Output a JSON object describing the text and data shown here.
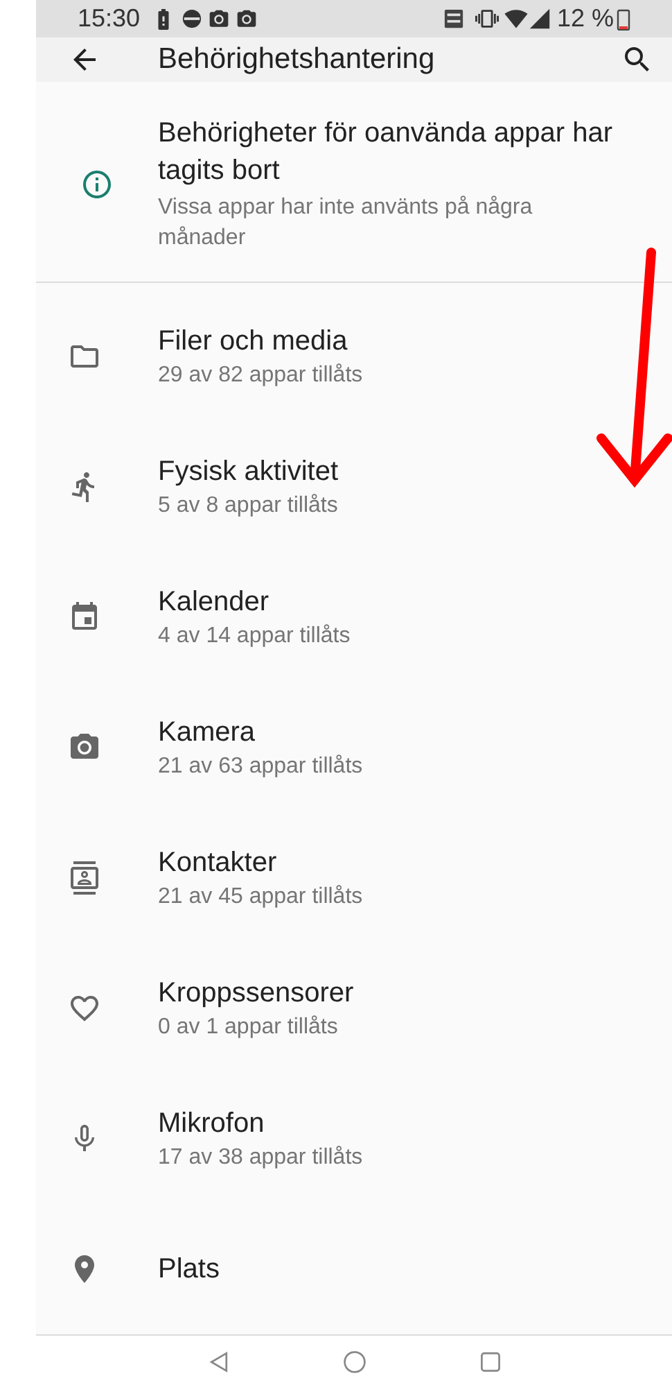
{
  "status_bar": {
    "time": "15:30",
    "battery": "12 %"
  },
  "app_bar": {
    "title": "Behörighetshantering"
  },
  "notice": {
    "title": "Behörigheter för oanvända appar har tagits bort",
    "subtitle": "Vissa appar har inte använts på några månader"
  },
  "permissions": [
    {
      "kind": "folder",
      "title": "Filer och media",
      "subtitle": "29 av 82 appar tillåts"
    },
    {
      "kind": "running",
      "title": "Fysisk aktivitet",
      "subtitle": "5 av 8 appar tillåts"
    },
    {
      "kind": "calendar",
      "title": "Kalender",
      "subtitle": "4 av 14 appar tillåts"
    },
    {
      "kind": "camera",
      "title": "Kamera",
      "subtitle": "21 av 63 appar tillåts"
    },
    {
      "kind": "contacts",
      "title": "Kontakter",
      "subtitle": "21 av 45 appar tillåts"
    },
    {
      "kind": "heart",
      "title": "Kroppssensorer",
      "subtitle": "0 av 1 appar tillåts"
    },
    {
      "kind": "mic",
      "title": "Mikrofon",
      "subtitle": "17 av 38 appar tillåts"
    },
    {
      "kind": "location",
      "title": "Plats"
    }
  ]
}
